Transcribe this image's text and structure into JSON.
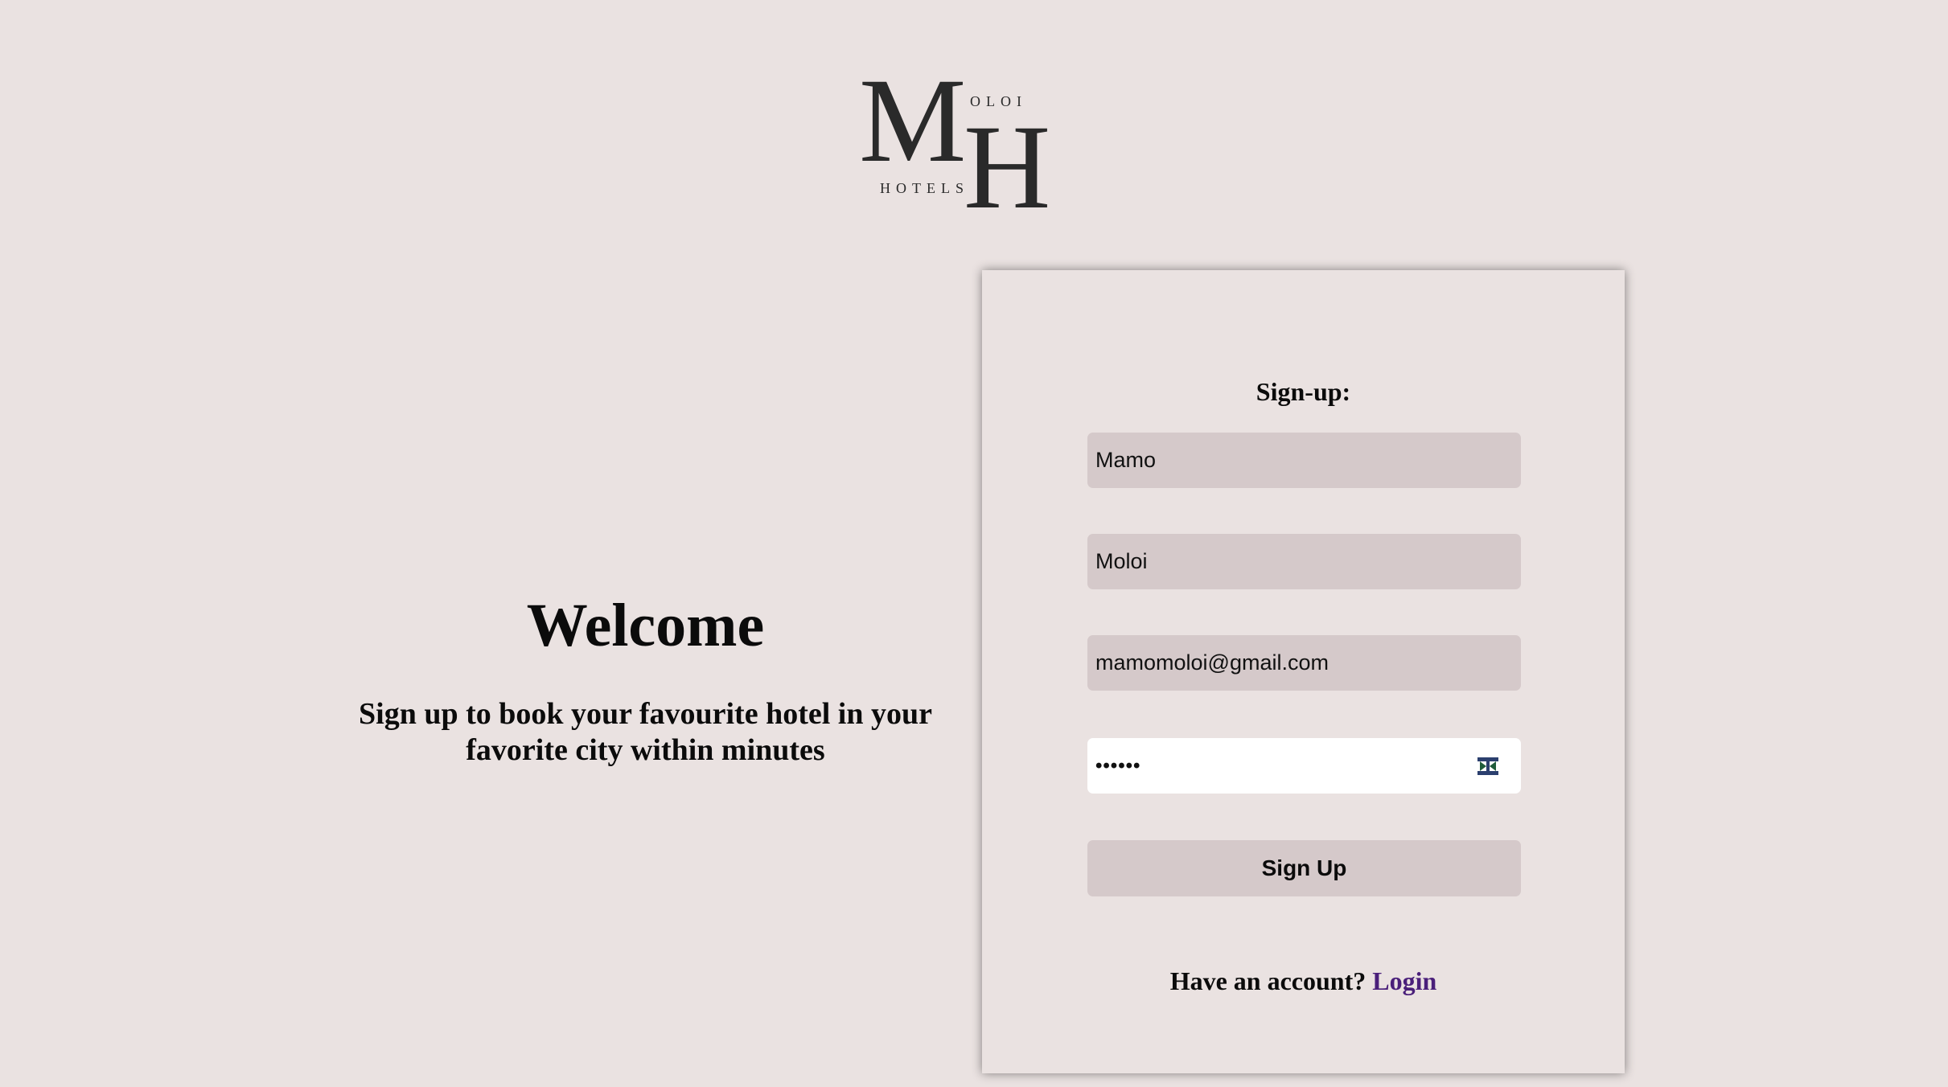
{
  "logo": {
    "big_m": "M",
    "big_h": "H",
    "small_top": "OLOI",
    "small_bottom": "HOTELS"
  },
  "welcome": {
    "title": "Welcome",
    "subtitle_line1": "Sign up to book your favourite hotel in your",
    "subtitle_line2": "favorite city within minutes"
  },
  "form": {
    "title": "Sign-up:",
    "first_name_value": "Mamo",
    "last_name_value": "Moloi",
    "email_value": "mamomoloi@gmail.com",
    "password_mask": "••••••",
    "password_toggle_icon": "eye-toggle-icon",
    "submit_label": "Sign Up",
    "account_prompt": "Have an account?",
    "login_link": "Login"
  },
  "colors": {
    "background": "#eae2e1",
    "input_fill": "#d5c9ca",
    "link": "#4a1f7a"
  }
}
